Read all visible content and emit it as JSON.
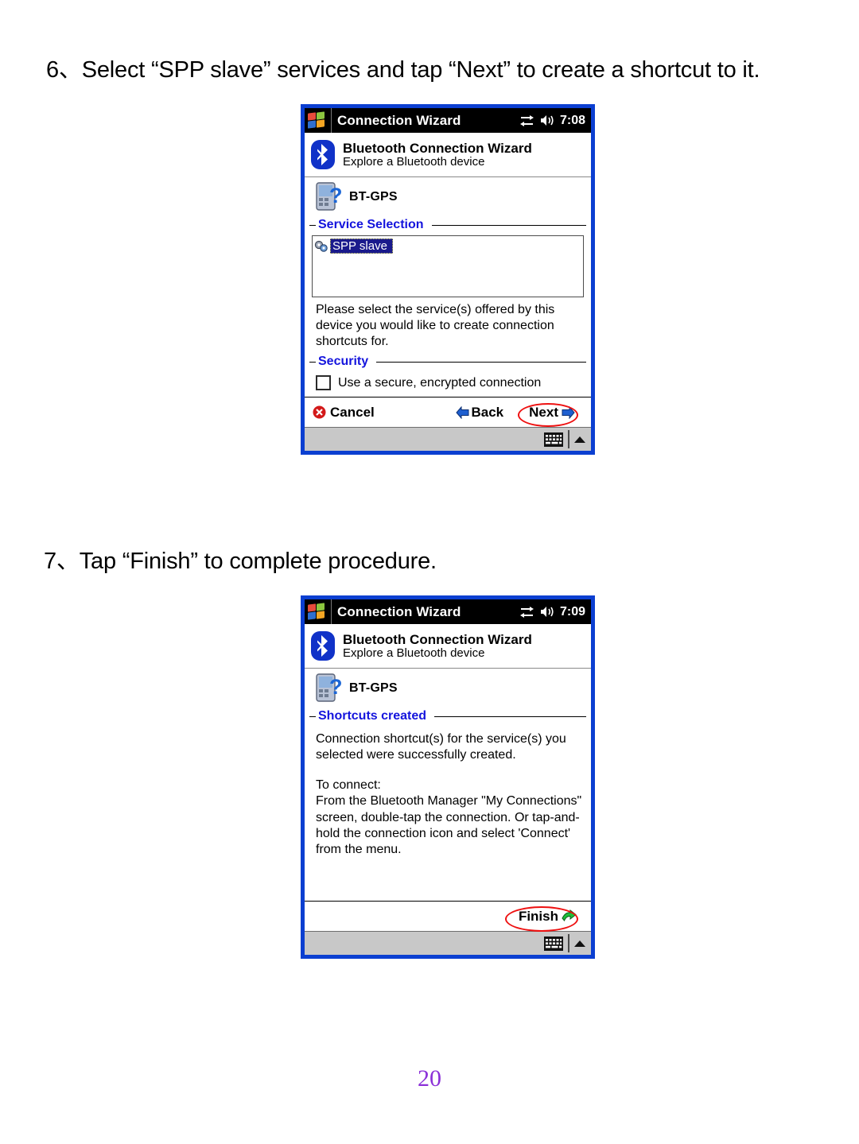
{
  "document": {
    "steps": [
      {
        "id": "step-6",
        "text": "6、Select “SPP slave” services and tap “Next” to create a shortcut to it."
      },
      {
        "id": "step-7",
        "text": "7、Tap “Finish” to complete procedure."
      }
    ],
    "page_number": "20",
    "page_number_color": "#8b30d8"
  },
  "screenshot_1": {
    "titlebar": {
      "title": "Connection Wizard",
      "time": "7:08",
      "icons": [
        "windows-flag-icon",
        "connectivity-icon",
        "speaker-icon"
      ]
    },
    "wizard_header": {
      "title": "Bluetooth Connection Wizard",
      "subtitle": "Explore a Bluetooth device",
      "icon": "bluetooth-icon"
    },
    "device": {
      "name": "BT-GPS",
      "icon": "unknown-device-icon"
    },
    "group": {
      "label": "Service Selection"
    },
    "service_list": {
      "items": [
        {
          "label": "SPP slave",
          "selected": true,
          "icon": "service-gear-icon"
        }
      ]
    },
    "instruction": "Please select the service(s) offered by this device you would like to create connection shortcuts for.",
    "security_group": {
      "label": "Security"
    },
    "security_checkbox": {
      "label": "Use a secure, encrypted connection",
      "checked": false
    },
    "commands": {
      "cancel": "Cancel",
      "back": "Back",
      "next": "Next",
      "highlighted": "Next",
      "highlight_color": "#ee1111"
    },
    "taskbar": {
      "icons": [
        "keyboard-icon",
        "input-panel-arrow-icon"
      ]
    }
  },
  "screenshot_2": {
    "titlebar": {
      "title": "Connection Wizard",
      "time": "7:09",
      "icons": [
        "windows-flag-icon",
        "connectivity-icon",
        "speaker-icon"
      ]
    },
    "wizard_header": {
      "title": "Bluetooth Connection Wizard",
      "subtitle": "Explore a Bluetooth device",
      "icon": "bluetooth-icon"
    },
    "device": {
      "name": "BT-GPS",
      "icon": "unknown-device-icon"
    },
    "group": {
      "label": "Shortcuts created"
    },
    "message_1": "Connection shortcut(s) for the service(s) you selected were successfully created.",
    "message_2": "To connect:",
    "message_3": "From the Bluetooth Manager \"My Connections\" screen, double-tap the connection. Or tap-and-hold the connection icon and select 'Connect' from the menu.",
    "commands": {
      "finish": "Finish",
      "highlighted": "Finish",
      "highlight_color": "#ee1111"
    },
    "taskbar": {
      "icons": [
        "keyboard-icon",
        "input-panel-arrow-icon"
      ]
    }
  }
}
